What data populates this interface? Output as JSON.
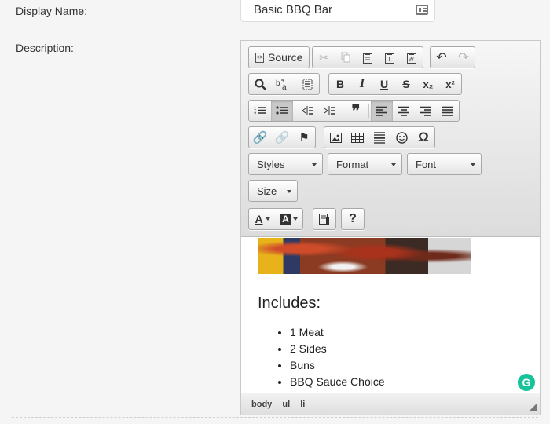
{
  "fields": {
    "display_name_label": "Display Name:",
    "display_name_value": "Basic BBQ Bar",
    "description_label": "Description:"
  },
  "toolbar": {
    "source_label": "Source",
    "styles_label": "Styles",
    "format_label": "Format",
    "font_label": "Font",
    "size_label": "Size",
    "bold_label": "B",
    "italic_label": "I",
    "underline_label": "U",
    "strike_label": "S",
    "subscript_label": "x₂",
    "superscript_label": "x²",
    "blockquote_label": "❞",
    "special_char_label": "Ω",
    "help_label": "?",
    "text_color_label": "A",
    "bg_color_label": "A"
  },
  "content": {
    "heading": "Includes:",
    "items": [
      "1 Meat",
      "2 Sides",
      "Buns",
      "BBQ Sauce Choice"
    ]
  },
  "statusbar": {
    "path": [
      "body",
      "ul",
      "li"
    ]
  },
  "grammarly_label": "G"
}
